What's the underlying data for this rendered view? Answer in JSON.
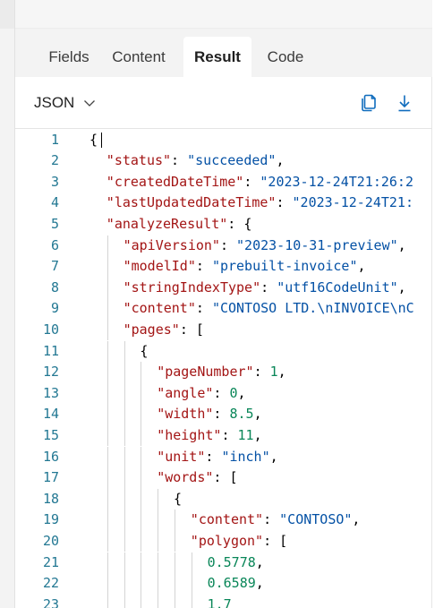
{
  "tabs": [
    {
      "label": "Fields"
    },
    {
      "label": "Content"
    },
    {
      "label": "Result"
    },
    {
      "label": "Code"
    }
  ],
  "toolbar": {
    "format_label": "JSON",
    "copy_icon": "copy-icon",
    "download_icon": "download-icon"
  },
  "code": {
    "colors": {
      "key": "#a31515",
      "string": "#0451a5",
      "number": "#098658",
      "line_number": "#237893"
    },
    "lines": [
      {
        "n": "1",
        "indent": 0,
        "tokens": [
          [
            "p",
            "{"
          ]
        ]
      },
      {
        "n": "2",
        "indent": 1,
        "tokens": [
          [
            "k",
            "\"status\""
          ],
          [
            "p",
            ": "
          ],
          [
            "s",
            "\"succeeded\""
          ],
          [
            "p",
            ","
          ]
        ]
      },
      {
        "n": "3",
        "indent": 1,
        "tokens": [
          [
            "k",
            "\"createdDateTime\""
          ],
          [
            "p",
            ": "
          ],
          [
            "s",
            "\"2023-12-24T21:26:2"
          ]
        ]
      },
      {
        "n": "4",
        "indent": 1,
        "tokens": [
          [
            "k",
            "\"lastUpdatedDateTime\""
          ],
          [
            "p",
            ": "
          ],
          [
            "s",
            "\"2023-12-24T21:"
          ]
        ]
      },
      {
        "n": "5",
        "indent": 1,
        "tokens": [
          [
            "k",
            "\"analyzeResult\""
          ],
          [
            "p",
            ": {"
          ]
        ]
      },
      {
        "n": "6",
        "indent": 2,
        "tokens": [
          [
            "k",
            "\"apiVersion\""
          ],
          [
            "p",
            ": "
          ],
          [
            "s",
            "\"2023-10-31-preview\""
          ],
          [
            "p",
            ","
          ]
        ]
      },
      {
        "n": "7",
        "indent": 2,
        "tokens": [
          [
            "k",
            "\"modelId\""
          ],
          [
            "p",
            ": "
          ],
          [
            "s",
            "\"prebuilt-invoice\""
          ],
          [
            "p",
            ","
          ]
        ]
      },
      {
        "n": "8",
        "indent": 2,
        "tokens": [
          [
            "k",
            "\"stringIndexType\""
          ],
          [
            "p",
            ": "
          ],
          [
            "s",
            "\"utf16CodeUnit\""
          ],
          [
            "p",
            ","
          ]
        ]
      },
      {
        "n": "9",
        "indent": 2,
        "tokens": [
          [
            "k",
            "\"content\""
          ],
          [
            "p",
            ": "
          ],
          [
            "s",
            "\"CONTOSO LTD.\\nINVOICE\\nC"
          ]
        ]
      },
      {
        "n": "10",
        "indent": 2,
        "tokens": [
          [
            "k",
            "\"pages\""
          ],
          [
            "p",
            ": ["
          ]
        ]
      },
      {
        "n": "11",
        "indent": 3,
        "tokens": [
          [
            "p",
            "{"
          ]
        ]
      },
      {
        "n": "12",
        "indent": 4,
        "tokens": [
          [
            "k",
            "\"pageNumber\""
          ],
          [
            "p",
            ": "
          ],
          [
            "n",
            "1"
          ],
          [
            "p",
            ","
          ]
        ]
      },
      {
        "n": "13",
        "indent": 4,
        "tokens": [
          [
            "k",
            "\"angle\""
          ],
          [
            "p",
            ": "
          ],
          [
            "n",
            "0"
          ],
          [
            "p",
            ","
          ]
        ]
      },
      {
        "n": "14",
        "indent": 4,
        "tokens": [
          [
            "k",
            "\"width\""
          ],
          [
            "p",
            ": "
          ],
          [
            "n",
            "8.5"
          ],
          [
            "p",
            ","
          ]
        ]
      },
      {
        "n": "15",
        "indent": 4,
        "tokens": [
          [
            "k",
            "\"height\""
          ],
          [
            "p",
            ": "
          ],
          [
            "n",
            "11"
          ],
          [
            "p",
            ","
          ]
        ]
      },
      {
        "n": "16",
        "indent": 4,
        "tokens": [
          [
            "k",
            "\"unit\""
          ],
          [
            "p",
            ": "
          ],
          [
            "s",
            "\"inch\""
          ],
          [
            "p",
            ","
          ]
        ]
      },
      {
        "n": "17",
        "indent": 4,
        "tokens": [
          [
            "k",
            "\"words\""
          ],
          [
            "p",
            ": ["
          ]
        ]
      },
      {
        "n": "18",
        "indent": 5,
        "tokens": [
          [
            "p",
            "{"
          ]
        ]
      },
      {
        "n": "19",
        "indent": 6,
        "tokens": [
          [
            "k",
            "\"content\""
          ],
          [
            "p",
            ": "
          ],
          [
            "s",
            "\"CONTOSO\""
          ],
          [
            "p",
            ","
          ]
        ]
      },
      {
        "n": "20",
        "indent": 6,
        "tokens": [
          [
            "k",
            "\"polygon\""
          ],
          [
            "p",
            ": ["
          ]
        ]
      },
      {
        "n": "21",
        "indent": 7,
        "tokens": [
          [
            "n",
            "0.5778"
          ],
          [
            "p",
            ","
          ]
        ]
      },
      {
        "n": "22",
        "indent": 7,
        "tokens": [
          [
            "n",
            "0.6589"
          ],
          [
            "p",
            ","
          ]
        ]
      },
      {
        "n": "23",
        "indent": 7,
        "tokens": [
          [
            "n",
            "1.7"
          ]
        ]
      }
    ]
  }
}
